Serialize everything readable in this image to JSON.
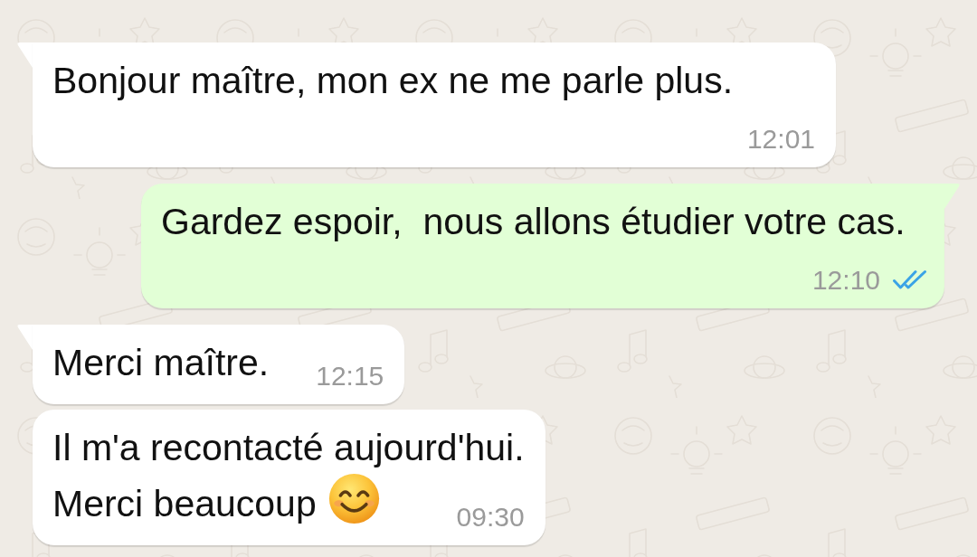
{
  "messages": [
    {
      "kind": "incoming",
      "tail": true,
      "text": "Bonjour maître, mon ex ne me parle plus.",
      "emoji": false,
      "time": "12:01"
    },
    {
      "kind": "outgoing",
      "tail": true,
      "text": "Gardez espoir,  nous allons étudier votre cas.",
      "emoji": false,
      "time": "12:10",
      "read": true
    },
    {
      "kind": "incoming",
      "tail": true,
      "text": "Merci maître.",
      "emoji": false,
      "time": "12:15"
    },
    {
      "kind": "incoming",
      "tail": false,
      "text": "Il m'a recontacté aujourd'hui.\nMerci beaucoup",
      "emoji": true,
      "time": "09:30"
    }
  ]
}
